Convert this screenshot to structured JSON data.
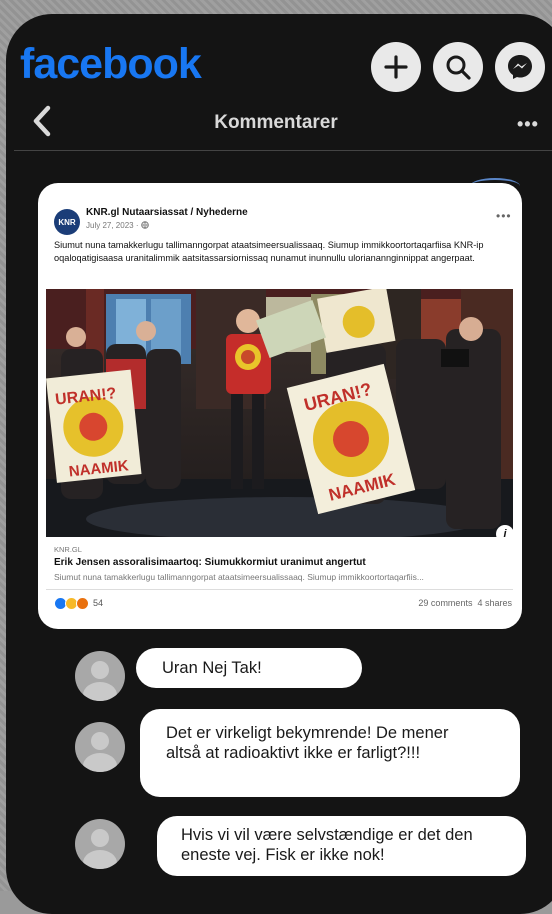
{
  "app": {
    "logo_text": "facebook"
  },
  "header": {
    "title": "Kommentarer",
    "more_label": "•••",
    "icons": [
      "add-icon",
      "search-icon",
      "messenger-icon",
      "back-chevron-icon"
    ]
  },
  "post": {
    "avatar_text": "KNR",
    "source": "KNR.gl Nutaarsiassat / Nyhederne",
    "date": "July 27, 2023 · ",
    "more_label": "•••",
    "text": "Siumut nuna tamakkerlugu tallimanngorpat ataatsimeersualissaaq. Siumup immikkoortortaqarfiisa KNR-ip oqaloqatigisaasa uranitalimmik aatsitassarsiornissaq nunamut inunnullu ulorianannginnippat angerpaat.",
    "info_label": "i",
    "link": {
      "domain": "KNR.GL",
      "title": "Erik Jensen assoralisimaartoq: Siumukkormiut uranimut angertut",
      "description": "Siumut nuna tamakkerlugu tallimanngorpat ataatsimeersualissaaq. Siumup immikkoortortaqarfiis..."
    },
    "reaction_count": "54",
    "comments_count": "29 comments",
    "shares_count": "4 shares",
    "photo_sign_texts": [
      "URAN!?",
      "NAAMIK"
    ]
  },
  "comments": [
    {
      "text": "Uran Nej Tak!"
    },
    {
      "text": "Det er virkeligt bekymrende! De mener altså at radioaktivt ikke er farligt?!!!"
    },
    {
      "text": "Hvis vi vil være selvstændige er det den eneste vej. Fisk er ikke nok!"
    }
  ],
  "colors": {
    "brand": "#1877f2",
    "background": "#141414",
    "header_text": "#d9d9d9",
    "bubble": "#ffffff",
    "reaction_like": "#1877f2",
    "reaction_haha": "#f7b928",
    "reaction_angry": "#e9710f"
  }
}
